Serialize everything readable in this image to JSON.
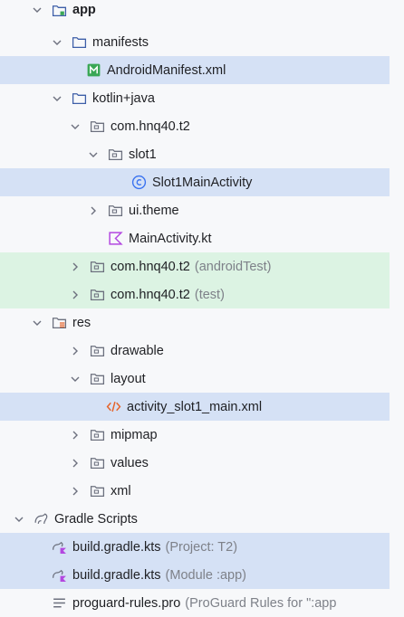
{
  "tree": {
    "app": "app",
    "manifests": "manifests",
    "android_manifest": "AndroidManifest.xml",
    "kotlin_java": "kotlin+java",
    "pkg_main": "com.hnq40.t2",
    "slot1": "slot1",
    "slot1_activity": "Slot1MainActivity",
    "ui_theme": "ui.theme",
    "main_activity": "MainActivity.kt",
    "pkg_android_test": "com.hnq40.t2",
    "pkg_android_test_suffix": "(androidTest)",
    "pkg_test": "com.hnq40.t2",
    "pkg_test_suffix": "(test)",
    "res": "res",
    "drawable": "drawable",
    "layout": "layout",
    "activity_slot1_main": "activity_slot1_main.xml",
    "mipmap": "mipmap",
    "values": "values",
    "xml": "xml",
    "gradle_scripts": "Gradle Scripts",
    "build_project": "build.gradle.kts",
    "build_project_suffix": "(Project: T2)",
    "build_module": "build.gradle.kts",
    "build_module_suffix": "(Module :app)",
    "proguard": "proguard-rules.pro",
    "proguard_suffix": "(ProGuard Rules for \":app"
  },
  "colors": {
    "selected": "#d5e1f5",
    "test_source": "#dcf3e3",
    "suffix_text": "#7e8189",
    "folder_icon": "#3d5ea8",
    "kotlin_icon": "#b347e0",
    "xml_icon": "#e5632a",
    "manifest_icon": "#3aa755",
    "class_icon": "#3b73f0"
  }
}
